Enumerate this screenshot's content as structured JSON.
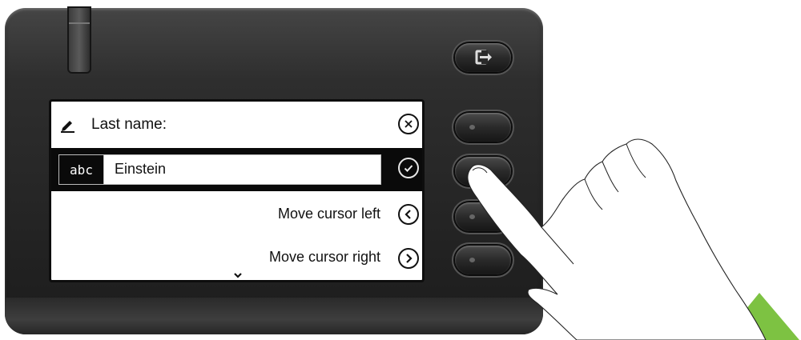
{
  "screen": {
    "title": "Last name:",
    "input_mode": "abc",
    "input_value": "Einstein",
    "options": [
      {
        "label": "Move cursor left",
        "icon": "chevron-left-icon"
      },
      {
        "label": "Move cursor right",
        "icon": "chevron-right-icon"
      }
    ],
    "more_indicator": "chevron-down-icon"
  },
  "icons": {
    "cancel": "close-icon",
    "confirm": "check-icon",
    "leave": "exit-arrow-icon",
    "title": "pencil-icon"
  },
  "colors": {
    "housing": "#1c1c1c",
    "screen_bg": "#ffffff",
    "selected_row": "#0a0a0a",
    "accent_green": "#7dc242"
  }
}
